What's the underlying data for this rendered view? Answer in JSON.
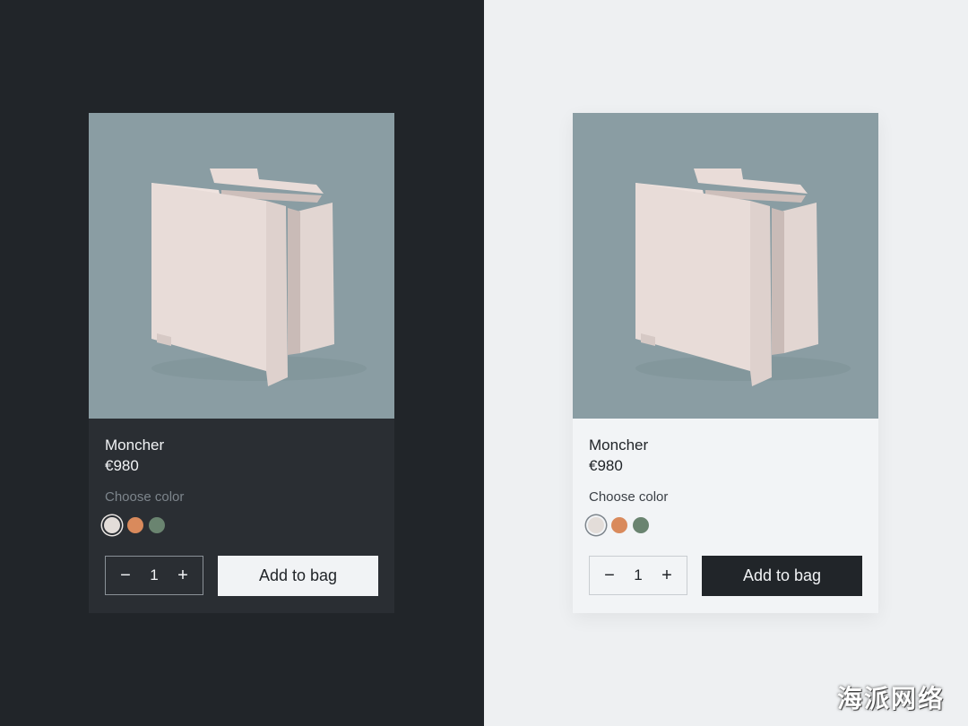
{
  "colors": {
    "dark_bg": "#212529",
    "dark_card": "#2a2e33",
    "light_bg": "#eef0f2",
    "light_card": "#f2f4f6",
    "image_bg": "#8a9da3",
    "swatch_options": [
      "#e3ddd9",
      "#d98a5c",
      "#6a8470"
    ]
  },
  "cards": [
    {
      "theme": "dark",
      "image_alt_icon": "chair-image",
      "name": "Moncher",
      "price": "€980",
      "color_label": "Choose color",
      "selected_color_index": 0,
      "quantity": "1",
      "minus_icon": "−",
      "plus_icon": "+",
      "add_label": "Add to bag"
    },
    {
      "theme": "light",
      "image_alt_icon": "chair-image",
      "name": "Moncher",
      "price": "€980",
      "color_label": "Choose color",
      "selected_color_index": 0,
      "quantity": "1",
      "minus_icon": "−",
      "plus_icon": "+",
      "add_label": "Add to bag"
    }
  ],
  "watermark": "海派网络"
}
